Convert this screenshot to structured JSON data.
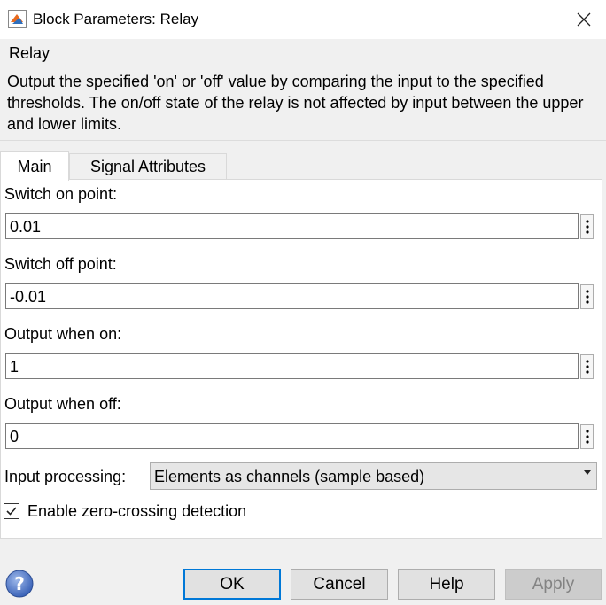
{
  "window": {
    "title": "Block Parameters: Relay"
  },
  "block": {
    "name": "Relay",
    "description": "Output the specified 'on' or 'off' value by comparing the input to the specified thresholds.  The on/off state of the relay is not affected by input between the upper and lower limits."
  },
  "tabs": [
    {
      "label": "Main",
      "active": true
    },
    {
      "label": "Signal Attributes",
      "active": false
    }
  ],
  "params": {
    "switch_on": {
      "label": "Switch on point:",
      "value": "0.01"
    },
    "switch_off": {
      "label": "Switch off point:",
      "value": "-0.01"
    },
    "output_on": {
      "label": "Output when on:",
      "value": "1"
    },
    "output_off": {
      "label": "Output when off:",
      "value": "0"
    },
    "input_processing": {
      "label": "Input processing:",
      "value": "Elements as channels (sample based)"
    },
    "zero_crossing": {
      "label": "Enable zero-crossing detection",
      "checked": true
    }
  },
  "buttons": {
    "ok": "OK",
    "cancel": "Cancel",
    "help": "Help",
    "apply": "Apply"
  },
  "icons": {
    "app": "simulink-block-icon",
    "close": "close-icon",
    "help": "help-question-icon",
    "more": "vertical-dots-icon",
    "dropdown": "dropdown-arrow-icon",
    "check": "check-icon"
  },
  "colors": {
    "focus_border": "#0078d7",
    "panel_bg": "#ffffff",
    "dialog_bg": "#f0f0f0"
  }
}
